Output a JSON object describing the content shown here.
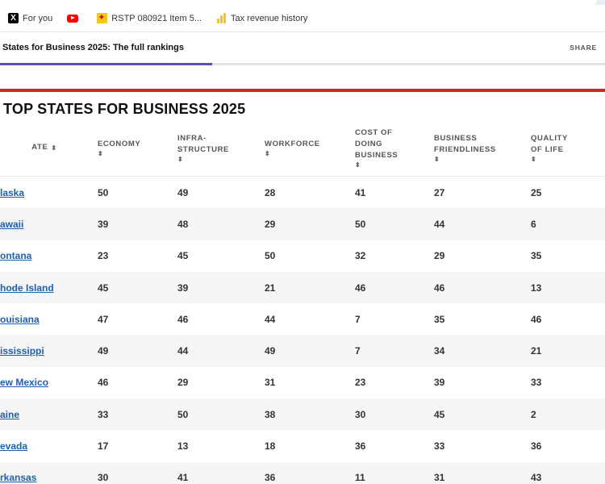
{
  "bookmarks": [
    {
      "label": "For you",
      "icon": "x-logo-icon"
    },
    {
      "label": "",
      "icon": "youtube-icon"
    },
    {
      "label": "RSTP 080921 Item 5...",
      "icon": "new-mexico-flag-icon"
    },
    {
      "label": "Tax revenue history",
      "icon": "power-bi-icon"
    }
  ],
  "article": {
    "title": "States for Business 2025: The full rankings",
    "share_label": "SHARE",
    "progress_percent": 35
  },
  "heading": "TOP STATES FOR BUSINESS 2025",
  "table": {
    "columns": [
      {
        "label": "ATE"
      },
      {
        "label": "ECONOMY"
      },
      {
        "label": "INFRA-\nSTRUCTURE"
      },
      {
        "label": "WORKFORCE"
      },
      {
        "label": "COST OF\nDOING\nBUSINESS"
      },
      {
        "label": "BUSINESS\nFRIENDLINESS"
      },
      {
        "label": "QUALITY\nOF LIFE"
      }
    ],
    "sort_glyph": "⬍",
    "rows": [
      {
        "state": "laska",
        "values": [
          "50",
          "49",
          "28",
          "41",
          "27",
          "25"
        ]
      },
      {
        "state": "awaii",
        "values": [
          "39",
          "48",
          "29",
          "50",
          "44",
          "6"
        ]
      },
      {
        "state": "ontana",
        "values": [
          "23",
          "45",
          "50",
          "32",
          "29",
          "35"
        ]
      },
      {
        "state": "hode Island",
        "values": [
          "45",
          "39",
          "21",
          "46",
          "46",
          "13"
        ]
      },
      {
        "state": "ouisiana",
        "values": [
          "47",
          "46",
          "44",
          "7",
          "35",
          "46"
        ]
      },
      {
        "state": "ississippi",
        "values": [
          "49",
          "44",
          "49",
          "7",
          "34",
          "21"
        ]
      },
      {
        "state": "ew Mexico",
        "values": [
          "46",
          "29",
          "31",
          "23",
          "39",
          "33"
        ]
      },
      {
        "state": "aine",
        "values": [
          "33",
          "50",
          "38",
          "30",
          "45",
          "2"
        ]
      },
      {
        "state": "evada",
        "values": [
          "17",
          "13",
          "18",
          "36",
          "33",
          "36"
        ]
      },
      {
        "state": "rkansas",
        "values": [
          "30",
          "41",
          "36",
          "11",
          "31",
          "43"
        ]
      }
    ]
  },
  "colors": {
    "accent_red": "#d51f2a",
    "link_blue": "#1f5fae",
    "progress_purple": "#5c4fb5"
  }
}
